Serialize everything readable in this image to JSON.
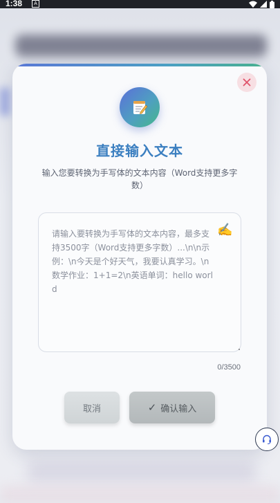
{
  "status_bar": {
    "time": "1:38",
    "notification_glyph": "A"
  },
  "dialog": {
    "icon": "memo-icon",
    "title": "直接输入文本",
    "subtitle": "输入您要转换为手写体的文本内容（Word支持更多字数）",
    "textarea": {
      "value": "",
      "placeholder": "请输入要转换为手写体的文本内容，最多支持3500字（Word支持更多字数）...\\n\\n示例：\\n今天是个好天气，我要认真学习。\\n数学作业：1+1=2\\n英语单词：hello world",
      "decoration_icon": "writing-hand-icon"
    },
    "counter": "0/3500",
    "cancel_label": "取消",
    "confirm_label": "确认输入"
  },
  "colors": {
    "title": "#3b7fc0",
    "close_icon": "#e0526a",
    "accent_gradient_start": "#5a77d6",
    "accent_gradient_end": "#46b78a"
  },
  "floating": {
    "support_icon": "headset-icon"
  }
}
